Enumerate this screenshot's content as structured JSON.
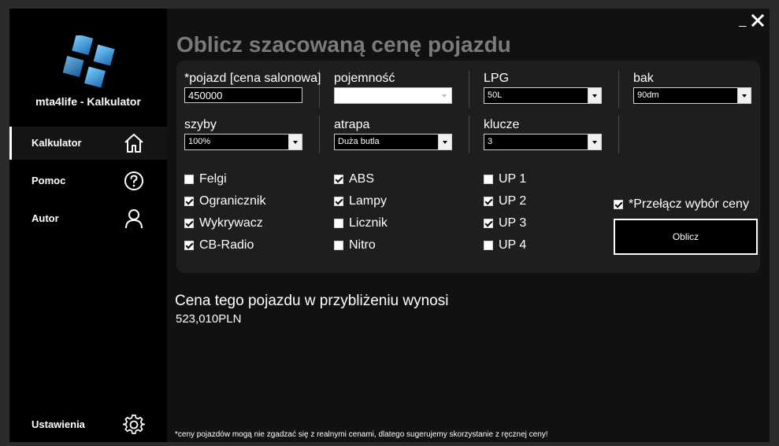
{
  "window": {
    "minimize_label": "_",
    "app_title": "mta4life - Kalkulator"
  },
  "sidebar": {
    "items": [
      {
        "label": "Kalkulator",
        "icon": "home-icon",
        "active": true
      },
      {
        "label": "Pomoc",
        "icon": "help-icon"
      },
      {
        "label": "Autor",
        "icon": "user-icon"
      }
    ],
    "settings": {
      "label": "Ustawienia",
      "icon": "gear-icon"
    }
  },
  "main": {
    "title": "Oblicz szacowaną cenę pojazdu",
    "fields": {
      "pojazd": {
        "label": "*pojazd [cena salonowa]",
        "value": "450000"
      },
      "pojemnosc": {
        "label": "pojemność",
        "value": ""
      },
      "lpg": {
        "label": "LPG",
        "value": "50L"
      },
      "bak": {
        "label": "bak",
        "value": "90dm"
      },
      "szyby": {
        "label": "szyby",
        "value": "100%"
      },
      "atrapa": {
        "label": "atrapa",
        "value": "Duża butla"
      },
      "klucze": {
        "label": "klucze",
        "value": "3"
      }
    },
    "checkboxes": {
      "col1": [
        {
          "label": "Felgi",
          "checked": false
        },
        {
          "label": "Ogranicznik",
          "checked": true
        },
        {
          "label": "Wykrywacz",
          "checked": true
        },
        {
          "label": "CB-Radio",
          "checked": true
        }
      ],
      "col2": [
        {
          "label": "ABS",
          "checked": true
        },
        {
          "label": "Lampy",
          "checked": true
        },
        {
          "label": "Licznik",
          "checked": false
        },
        {
          "label": "Nitro",
          "checked": false
        }
      ],
      "col3": [
        {
          "label": "UP 1",
          "checked": false
        },
        {
          "label": "UP 2",
          "checked": true
        },
        {
          "label": "UP 3",
          "checked": true
        },
        {
          "label": "UP 4",
          "checked": false
        }
      ]
    },
    "price_toggle": {
      "label": "*Przełącz wybór ceny",
      "checked": true
    },
    "calculate_label": "Oblicz",
    "result": {
      "title": "Cena tego pojazdu w przybliżeniu wynosi",
      "value": "523,010PLN"
    },
    "footnote": "*ceny pojazdów mogą nie zgadzać się z realnymi cenami, dlatego sugerujemy skorzystanie z ręcznej ceny!"
  },
  "colors": {
    "background": "#111111",
    "sidebar": "#000000",
    "panel": "#1e1e1e",
    "title": "#7a7a7a",
    "logo_blue": "#2f8fd4"
  }
}
